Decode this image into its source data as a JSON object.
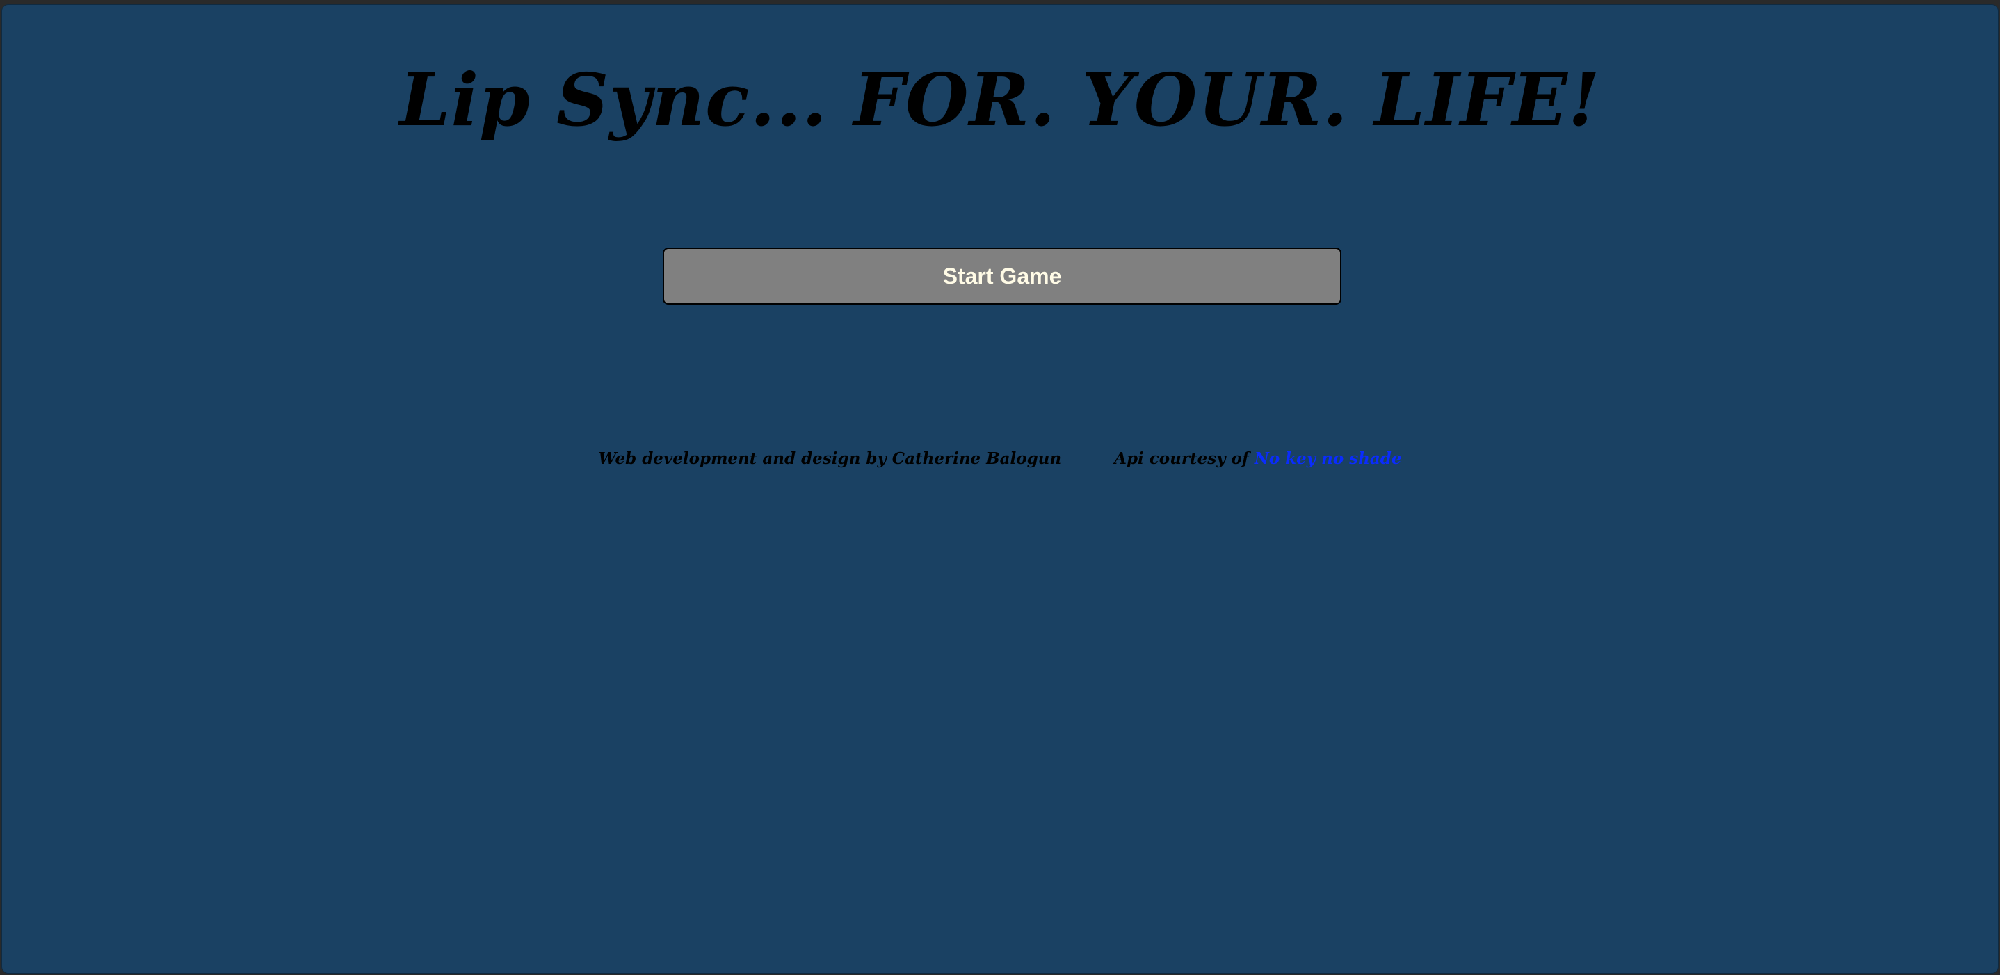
{
  "page": {
    "title": "Lip Sync... FOR. YOUR. LIFE!",
    "start_button_label": "Start Game"
  },
  "footer": {
    "credit": "Web development and design by Catherine Balogun",
    "api_prefix": "Api courtesy of",
    "api_link_label": "No key no shade"
  },
  "colors": {
    "background": "#1a4163",
    "button_bg": "#808080",
    "button_text": "#fffbe6",
    "link": "#0a2cff"
  }
}
